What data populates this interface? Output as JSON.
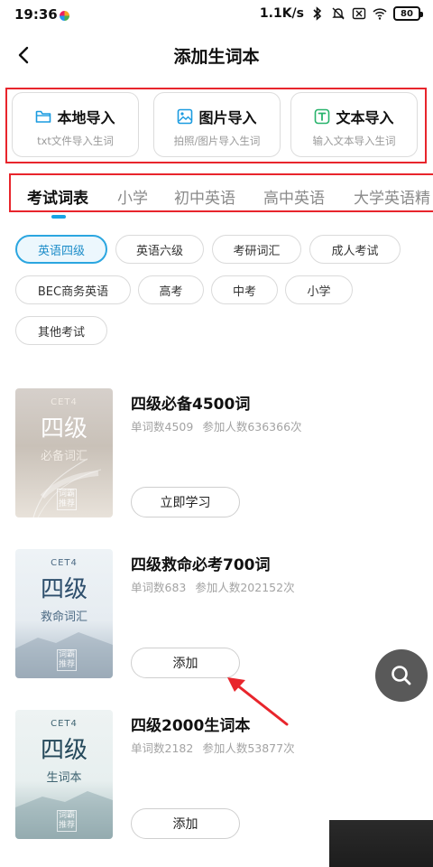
{
  "status_bar": {
    "time": "19:36",
    "speed": "1.1K/s",
    "battery": "80"
  },
  "header": {
    "title": "添加生词本"
  },
  "imports": [
    {
      "title": "本地导入",
      "subtitle": "txt文件导入生词",
      "icon": "folder-icon"
    },
    {
      "title": "图片导入",
      "subtitle": "拍照/图片导入生词",
      "icon": "image-icon"
    },
    {
      "title": "文本导入",
      "subtitle": "输入文本导入生词",
      "icon": "text-icon"
    }
  ],
  "tabs": [
    {
      "label": "考试词表",
      "active": true
    },
    {
      "label": "小学",
      "active": false
    },
    {
      "label": "初中英语",
      "active": false
    },
    {
      "label": "高中英语",
      "active": false
    },
    {
      "label": "大学英语精",
      "active": false
    }
  ],
  "filters": [
    {
      "label": "英语四级",
      "active": true
    },
    {
      "label": "英语六级",
      "active": false
    },
    {
      "label": "考研词汇",
      "active": false
    },
    {
      "label": "成人考试",
      "active": false
    },
    {
      "label": "BEC商务英语",
      "active": false
    },
    {
      "label": "高考",
      "active": false
    },
    {
      "label": "中考",
      "active": false
    },
    {
      "label": "小学",
      "active": false
    },
    {
      "label": "其他考试",
      "active": false
    }
  ],
  "books": [
    {
      "title": "四级必备4500词",
      "word_count": "单词数4509",
      "participants": "参加人数636366次",
      "action": "立即学习",
      "cover": {
        "tag": "CET4",
        "big": "四级",
        "small": "必备词汇",
        "stamp": "词霸推荐"
      }
    },
    {
      "title": "四级救命必考700词",
      "word_count": "单词数683",
      "participants": "参加人数202152次",
      "action": "添加",
      "cover": {
        "tag": "CET4",
        "big": "四级",
        "small": "救命词汇",
        "stamp": "词霸推荐"
      }
    },
    {
      "title": "四级2000生词本",
      "word_count": "单词数2182",
      "participants": "参加人数53877次",
      "action": "添加",
      "cover": {
        "tag": "CET4",
        "big": "四级",
        "small": "生词本",
        "stamp": "词霸推荐"
      }
    }
  ],
  "colors": {
    "accent": "#17a4e6",
    "annotation_red": "#e8252c",
    "fab": "#595959"
  }
}
